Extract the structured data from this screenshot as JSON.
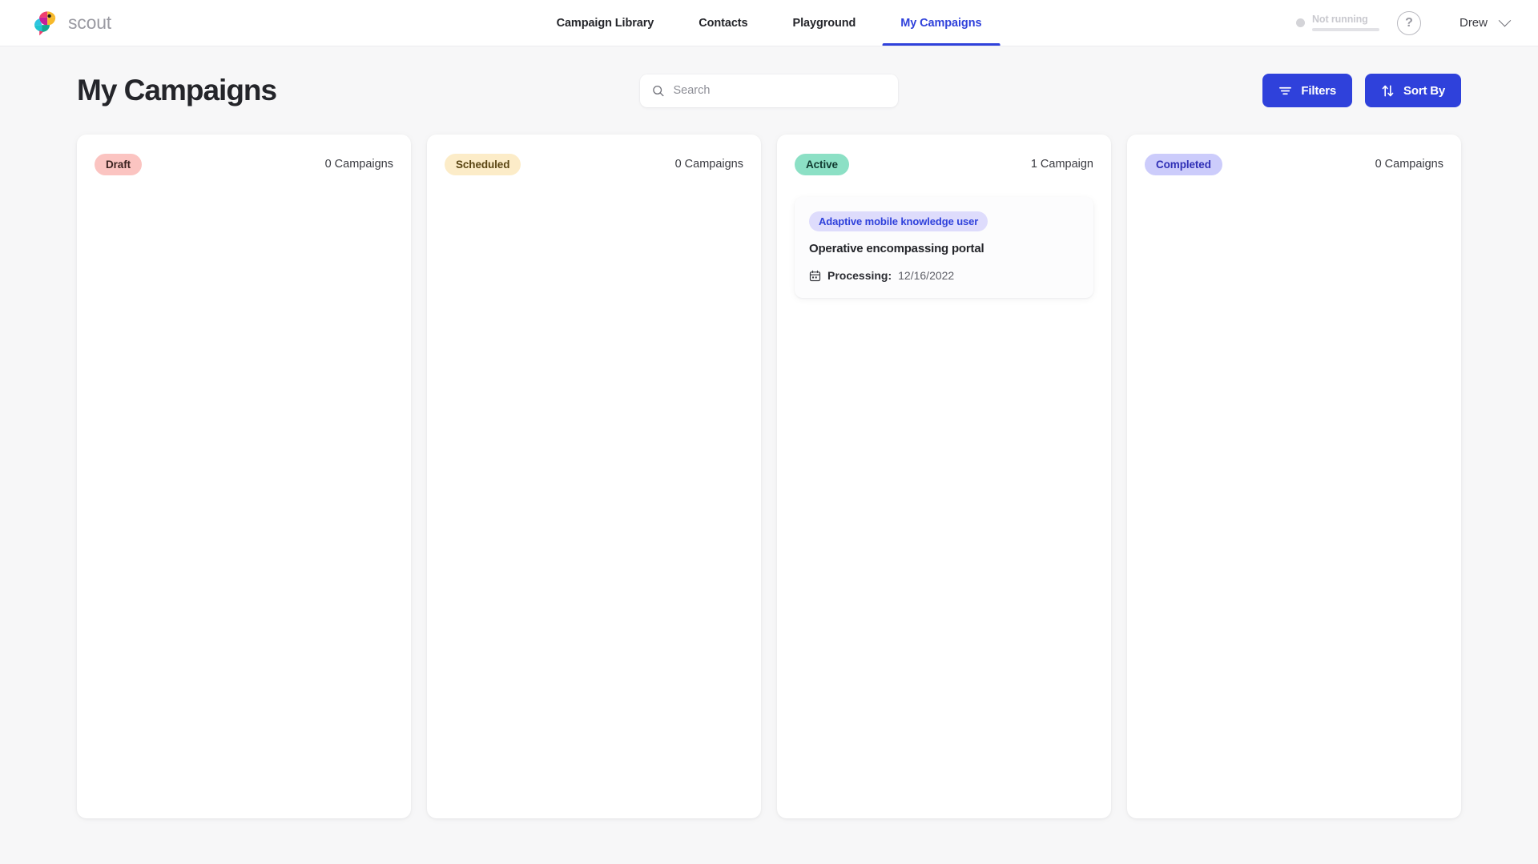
{
  "brand": {
    "name": "scout",
    "logo_icon": "parrot-logo-icon"
  },
  "nav": {
    "items": [
      {
        "label": "Campaign Library",
        "active": false
      },
      {
        "label": "Contacts",
        "active": false
      },
      {
        "label": "Playground",
        "active": false
      },
      {
        "label": "My Campaigns",
        "active": true
      }
    ]
  },
  "header_right": {
    "status_text": "Not running",
    "status_dot_color": "#d4d4d8",
    "help_icon": "question-mark-icon",
    "help_label": "?",
    "user_name": "Drew",
    "chevron_icon": "chevron-down-icon"
  },
  "toolbar": {
    "page_title": "My Campaigns",
    "search_placeholder": "Search",
    "search_value": "",
    "search_icon": "search-icon",
    "filters_label": "Filters",
    "filters_icon": "filter-icon",
    "sort_label": "Sort By",
    "sort_icon": "sort-arrows-icon",
    "accent_color": "#2f41db"
  },
  "board": {
    "columns": [
      {
        "status": "Draft",
        "count_label": "0 Campaigns",
        "badge_bg": "#fbc4c1",
        "cards": []
      },
      {
        "status": "Scheduled",
        "count_label": "0 Campaigns",
        "badge_bg": "#fcecc8",
        "cards": []
      },
      {
        "status": "Active",
        "count_label": "1 Campaign",
        "badge_bg": "#8ce0c5",
        "cards": [
          {
            "tag": "Adaptive mobile knowledge user",
            "title": "Operative encompassing portal",
            "meta_icon": "calendar-icon",
            "meta_label": "Processing:",
            "meta_value": "12/16/2022"
          }
        ]
      },
      {
        "status": "Completed",
        "count_label": "0 Campaigns",
        "badge_bg": "#ccccfb",
        "cards": []
      }
    ]
  }
}
